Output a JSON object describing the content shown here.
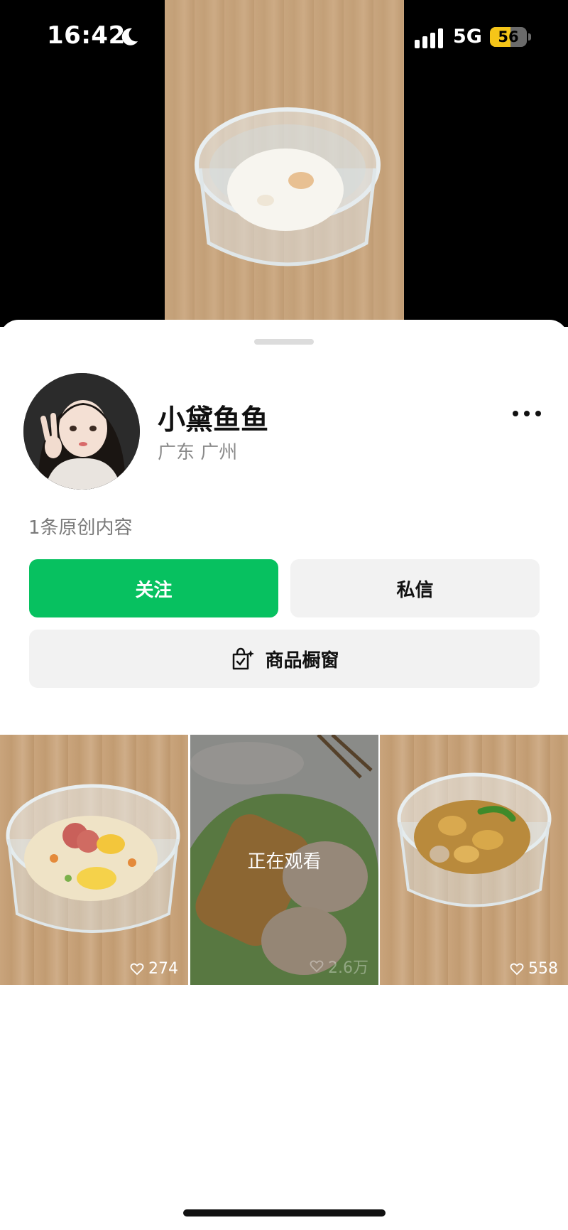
{
  "status_bar": {
    "time": "16:42",
    "network": "5G",
    "battery": "56",
    "battery_level_percent": 56
  },
  "profile": {
    "name": "小黛鱼鱼",
    "location": "广东 广州",
    "original_count_text": "1条原创内容"
  },
  "buttons": {
    "follow": "关注",
    "message": "私信",
    "shop": "商品橱窗"
  },
  "grid": {
    "items": [
      {
        "likes": "274"
      },
      {
        "likes": "2.6万",
        "overlay": "正在观看"
      },
      {
        "likes": "558"
      }
    ]
  },
  "colors": {
    "accent": "#07c160",
    "button_bg": "#f2f2f2",
    "secondary_text": "#8a8a8a"
  },
  "icons": [
    "moon-icon",
    "signal-icon",
    "more-icon",
    "shop-icon",
    "heart-icon"
  ]
}
